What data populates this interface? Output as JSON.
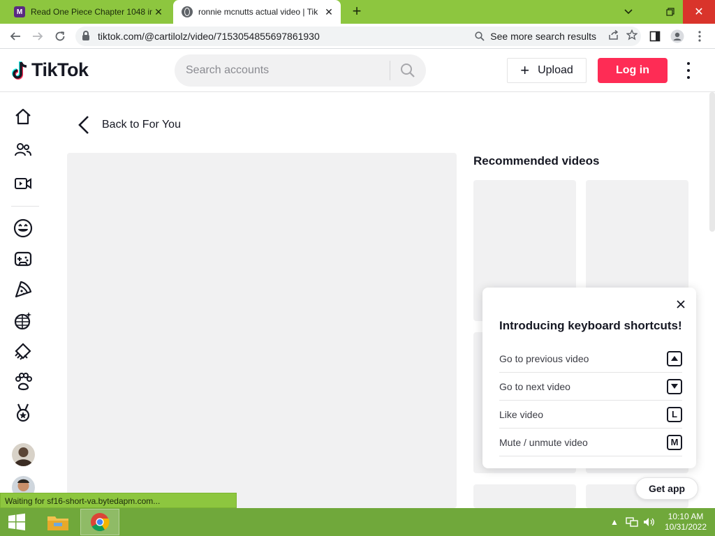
{
  "browser": {
    "tabs": [
      {
        "title": "Read One Piece Chapter 1048 in",
        "favicon": "manga-m-icon",
        "favicon_text": "M",
        "active": false
      },
      {
        "title": "ronnie mcnutts actual video | Tik",
        "favicon": "globe-icon",
        "active": true
      }
    ],
    "url": "tiktok.com/@cartilolz/video/7153054855697861930",
    "omnibox_action": "See more search results",
    "status_text": "Waiting for sf16-short-va.bytedapm.com..."
  },
  "header": {
    "logo_text": "TikTok",
    "search_placeholder": "Search accounts",
    "upload_label": "Upload",
    "login_label": "Log in"
  },
  "main": {
    "back_label": "Back to For You",
    "recommended_title": "Recommended videos"
  },
  "popup": {
    "title": "Introducing keyboard shortcuts!",
    "shortcuts": [
      {
        "label": "Go to previous video",
        "key": "up-arrow"
      },
      {
        "label": "Go to next video",
        "key": "down-arrow"
      },
      {
        "label": "Like video",
        "key": "L"
      },
      {
        "label": "Mute / unmute video",
        "key": "M"
      }
    ]
  },
  "get_app_label": "Get app",
  "taskbar": {
    "time": "10:10 AM",
    "date": "10/31/2022"
  },
  "colors": {
    "accent": "#fe2c55",
    "chrome_frame": "#8dc63f",
    "taskbar": "#70a83b",
    "placeholder": "#f1f1f2"
  }
}
